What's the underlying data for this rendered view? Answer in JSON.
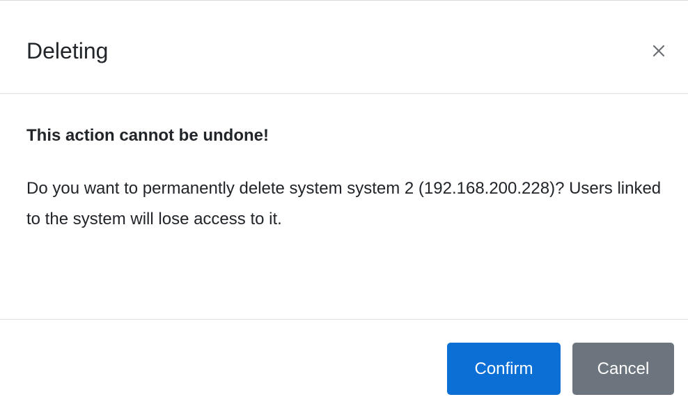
{
  "dialog": {
    "title": "Deleting",
    "close_icon": "close-icon",
    "warning": "This action cannot be undone!",
    "message": "Do you want to permanently delete system system 2 (192.168.200.228)? Users linked to the system will lose access to it.",
    "confirm_label": "Confirm",
    "cancel_label": "Cancel"
  },
  "colors": {
    "confirm_button": "#0b6fd6",
    "cancel_button": "#6c757d",
    "divider": "#dee2e6",
    "text": "#212529"
  }
}
